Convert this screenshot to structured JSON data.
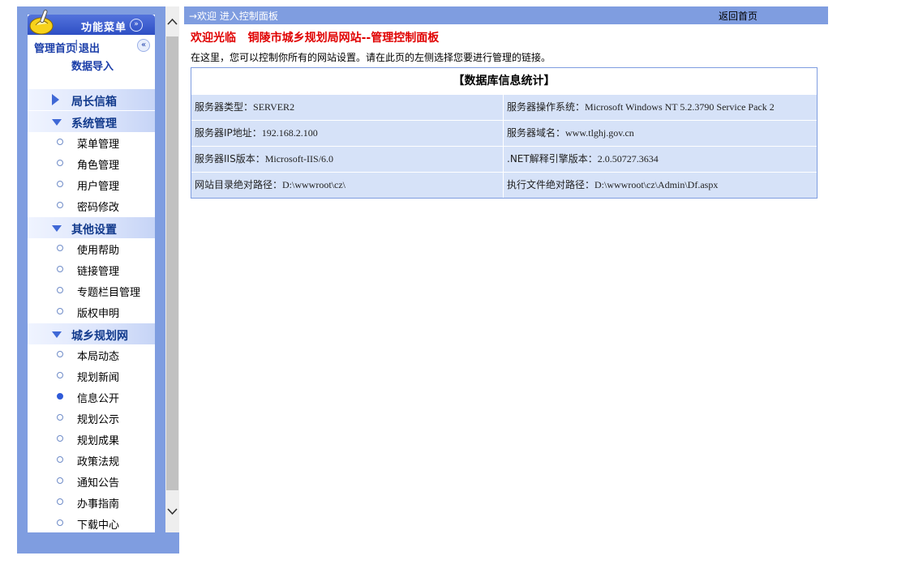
{
  "sidebar": {
    "header_title": "功能菜单",
    "home_link": "管理首页",
    "separator": "|",
    "logout_link": "退出",
    "data_import_link": "数据导入",
    "groups": [
      {
        "label": "局长信箱",
        "expanded": false,
        "items": []
      },
      {
        "label": "系统管理",
        "expanded": true,
        "items": [
          "菜单管理",
          "角色管理",
          "用户管理",
          "密码修改"
        ]
      },
      {
        "label": "其他设置",
        "expanded": true,
        "items": [
          "使用帮助",
          "链接管理",
          "专题栏目管理",
          "版权申明"
        ]
      },
      {
        "label": "城乡规划网",
        "expanded": true,
        "items": [
          "本局动态",
          "规划新闻",
          "信息公开",
          "规划公示",
          "规划成果",
          "政策法规",
          "通知公告",
          "办事指南",
          "下载中心"
        ]
      }
    ],
    "active_item": "信息公开"
  },
  "topbar": {
    "breadcrumb": "→欢迎 进入控制面板",
    "back_home": "返回首页"
  },
  "main": {
    "welcome": "欢迎光临   铜陵市城乡规划局网站--管理控制面板",
    "intro": "在这里，您可以控制你所有的网站设置。请在此页的左侧选择您要进行管理的链接。",
    "table": {
      "caption": "【数据库信息统计】",
      "rows": [
        [
          {
            "key": "服务器类型：",
            "value": "SERVER2"
          },
          {
            "key": "服务器操作系统：",
            "value": "Microsoft Windows NT 5.2.3790 Service Pack 2"
          }
        ],
        [
          {
            "key": "服务器IP地址：",
            "value": "192.168.2.100"
          },
          {
            "key": "服务器域名：",
            "value": "www.tlghj.gov.cn"
          }
        ],
        [
          {
            "key": "服务器IIS版本：",
            "value": "Microsoft-IIS/6.0"
          },
          {
            "key": ".NET解释引擎版本：",
            "value": "2.0.50727.3634"
          }
        ],
        [
          {
            "key": "网站目录绝对路径：",
            "value": "D:\\wwwroot\\cz\\"
          },
          {
            "key": "执行文件绝对路径：",
            "value": "D:\\wwwroot\\cz\\Admin\\Df.aspx"
          }
        ]
      ]
    }
  },
  "colors": {
    "frame_blue": "#7f9de0",
    "header_blue": "#3f5fd0",
    "welcome_red": "#e00000",
    "row_bg": "#d6e2f8"
  },
  "icons": {
    "logo": "broom-icon",
    "collapse": "double-chevron-down-icon",
    "hide": "double-chevron-left-icon",
    "scroll_up": "chevron-up-icon",
    "scroll_down": "chevron-down-icon"
  }
}
